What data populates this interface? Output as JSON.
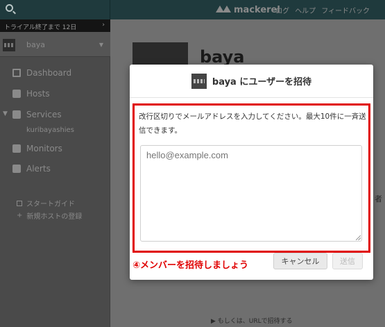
{
  "header": {
    "logo_text": "mackerel",
    "nav_links": [
      "ログ",
      "ヘルプ",
      "フィードバック"
    ]
  },
  "sidebar": {
    "trial_text": "トライアル終了まで 12日",
    "org_name": "baya",
    "items": [
      {
        "label": "Dashboard",
        "icon": "dashboard-icon"
      },
      {
        "label": "Hosts",
        "icon": "hosts-icon"
      },
      {
        "label": "Services",
        "icon": "services-icon"
      },
      {
        "label": "Monitors",
        "icon": "monitors-icon"
      },
      {
        "label": "Alerts",
        "icon": "alerts-icon"
      }
    ],
    "sub_item": "kuribayashies",
    "footer_links": [
      "スタートガイド",
      "新規ホストの登録"
    ]
  },
  "main": {
    "org_title": "baya",
    "side_glyph": "者",
    "url_link": "▶ もしくは、URLで招待する"
  },
  "modal": {
    "title": "baya にユーザーを招待",
    "description": "改行区切りでメールアドレスを入力してください。最大10件に一斉送信できます。",
    "textarea_placeholder": "hello@example.com",
    "annotation": "④メンバーを招待しましょう",
    "cancel_label": "キャンセル",
    "send_label": "送信",
    "highlight_color": "#e00000"
  }
}
